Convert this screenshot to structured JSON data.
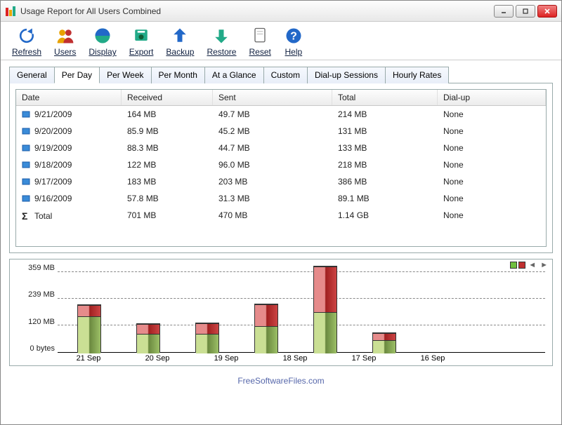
{
  "window": {
    "title": "Usage Report for All Users Combined"
  },
  "toolbar": [
    {
      "label": "Refresh",
      "icon": "refresh"
    },
    {
      "label": "Users",
      "icon": "users"
    },
    {
      "label": "Display",
      "icon": "display"
    },
    {
      "label": "Export",
      "icon": "export"
    },
    {
      "label": "Backup",
      "icon": "backup"
    },
    {
      "label": "Restore",
      "icon": "restore"
    },
    {
      "label": "Reset",
      "icon": "reset"
    },
    {
      "label": "Help",
      "icon": "help"
    }
  ],
  "tabs": [
    "General",
    "Per Day",
    "Per Week",
    "Per Month",
    "At a Glance",
    "Custom",
    "Dial-up Sessions",
    "Hourly Rates"
  ],
  "active_tab": "Per Day",
  "columns": [
    "Date",
    "Received",
    "Sent",
    "Total",
    "Dial-up"
  ],
  "rows": [
    {
      "date": "9/21/2009",
      "received": "164 MB",
      "sent": "49.7 MB",
      "total": "214 MB",
      "dialup": "None"
    },
    {
      "date": "9/20/2009",
      "received": "85.9 MB",
      "sent": "45.2 MB",
      "total": "131 MB",
      "dialup": "None"
    },
    {
      "date": "9/19/2009",
      "received": "88.3 MB",
      "sent": "44.7 MB",
      "total": "133 MB",
      "dialup": "None"
    },
    {
      "date": "9/18/2009",
      "received": "122 MB",
      "sent": "96.0 MB",
      "total": "218 MB",
      "dialup": "None"
    },
    {
      "date": "9/17/2009",
      "received": "183 MB",
      "sent": "203 MB",
      "total": "386 MB",
      "dialup": "None"
    },
    {
      "date": "9/16/2009",
      "received": "57.8 MB",
      "sent": "31.3 MB",
      "total": "89.1 MB",
      "dialup": "None"
    }
  ],
  "totals": {
    "label": "Total",
    "received": "701 MB",
    "sent": "470 MB",
    "total": "1.14 GB",
    "dialup": "None"
  },
  "chart_data": {
    "type": "bar",
    "categories": [
      "21 Sep",
      "20 Sep",
      "19 Sep",
      "18 Sep",
      "17 Sep",
      "16 Sep"
    ],
    "series": [
      {
        "name": "Received",
        "values": [
          164,
          85.9,
          88.3,
          122,
          183,
          57.8
        ]
      },
      {
        "name": "Sent",
        "values": [
          49.7,
          45.2,
          44.7,
          96.0,
          203,
          31.3
        ]
      }
    ],
    "y_ticks": [
      "359 MB",
      "239 MB",
      "120 MB",
      "0 bytes"
    ],
    "ylim": [
      0,
      395
    ],
    "ylabel": "",
    "xlabel": ""
  },
  "legend_colors": {
    "received": "#6fbf3f",
    "sent": "#c03030"
  },
  "footer": "FreeSoftwareFiles.com"
}
